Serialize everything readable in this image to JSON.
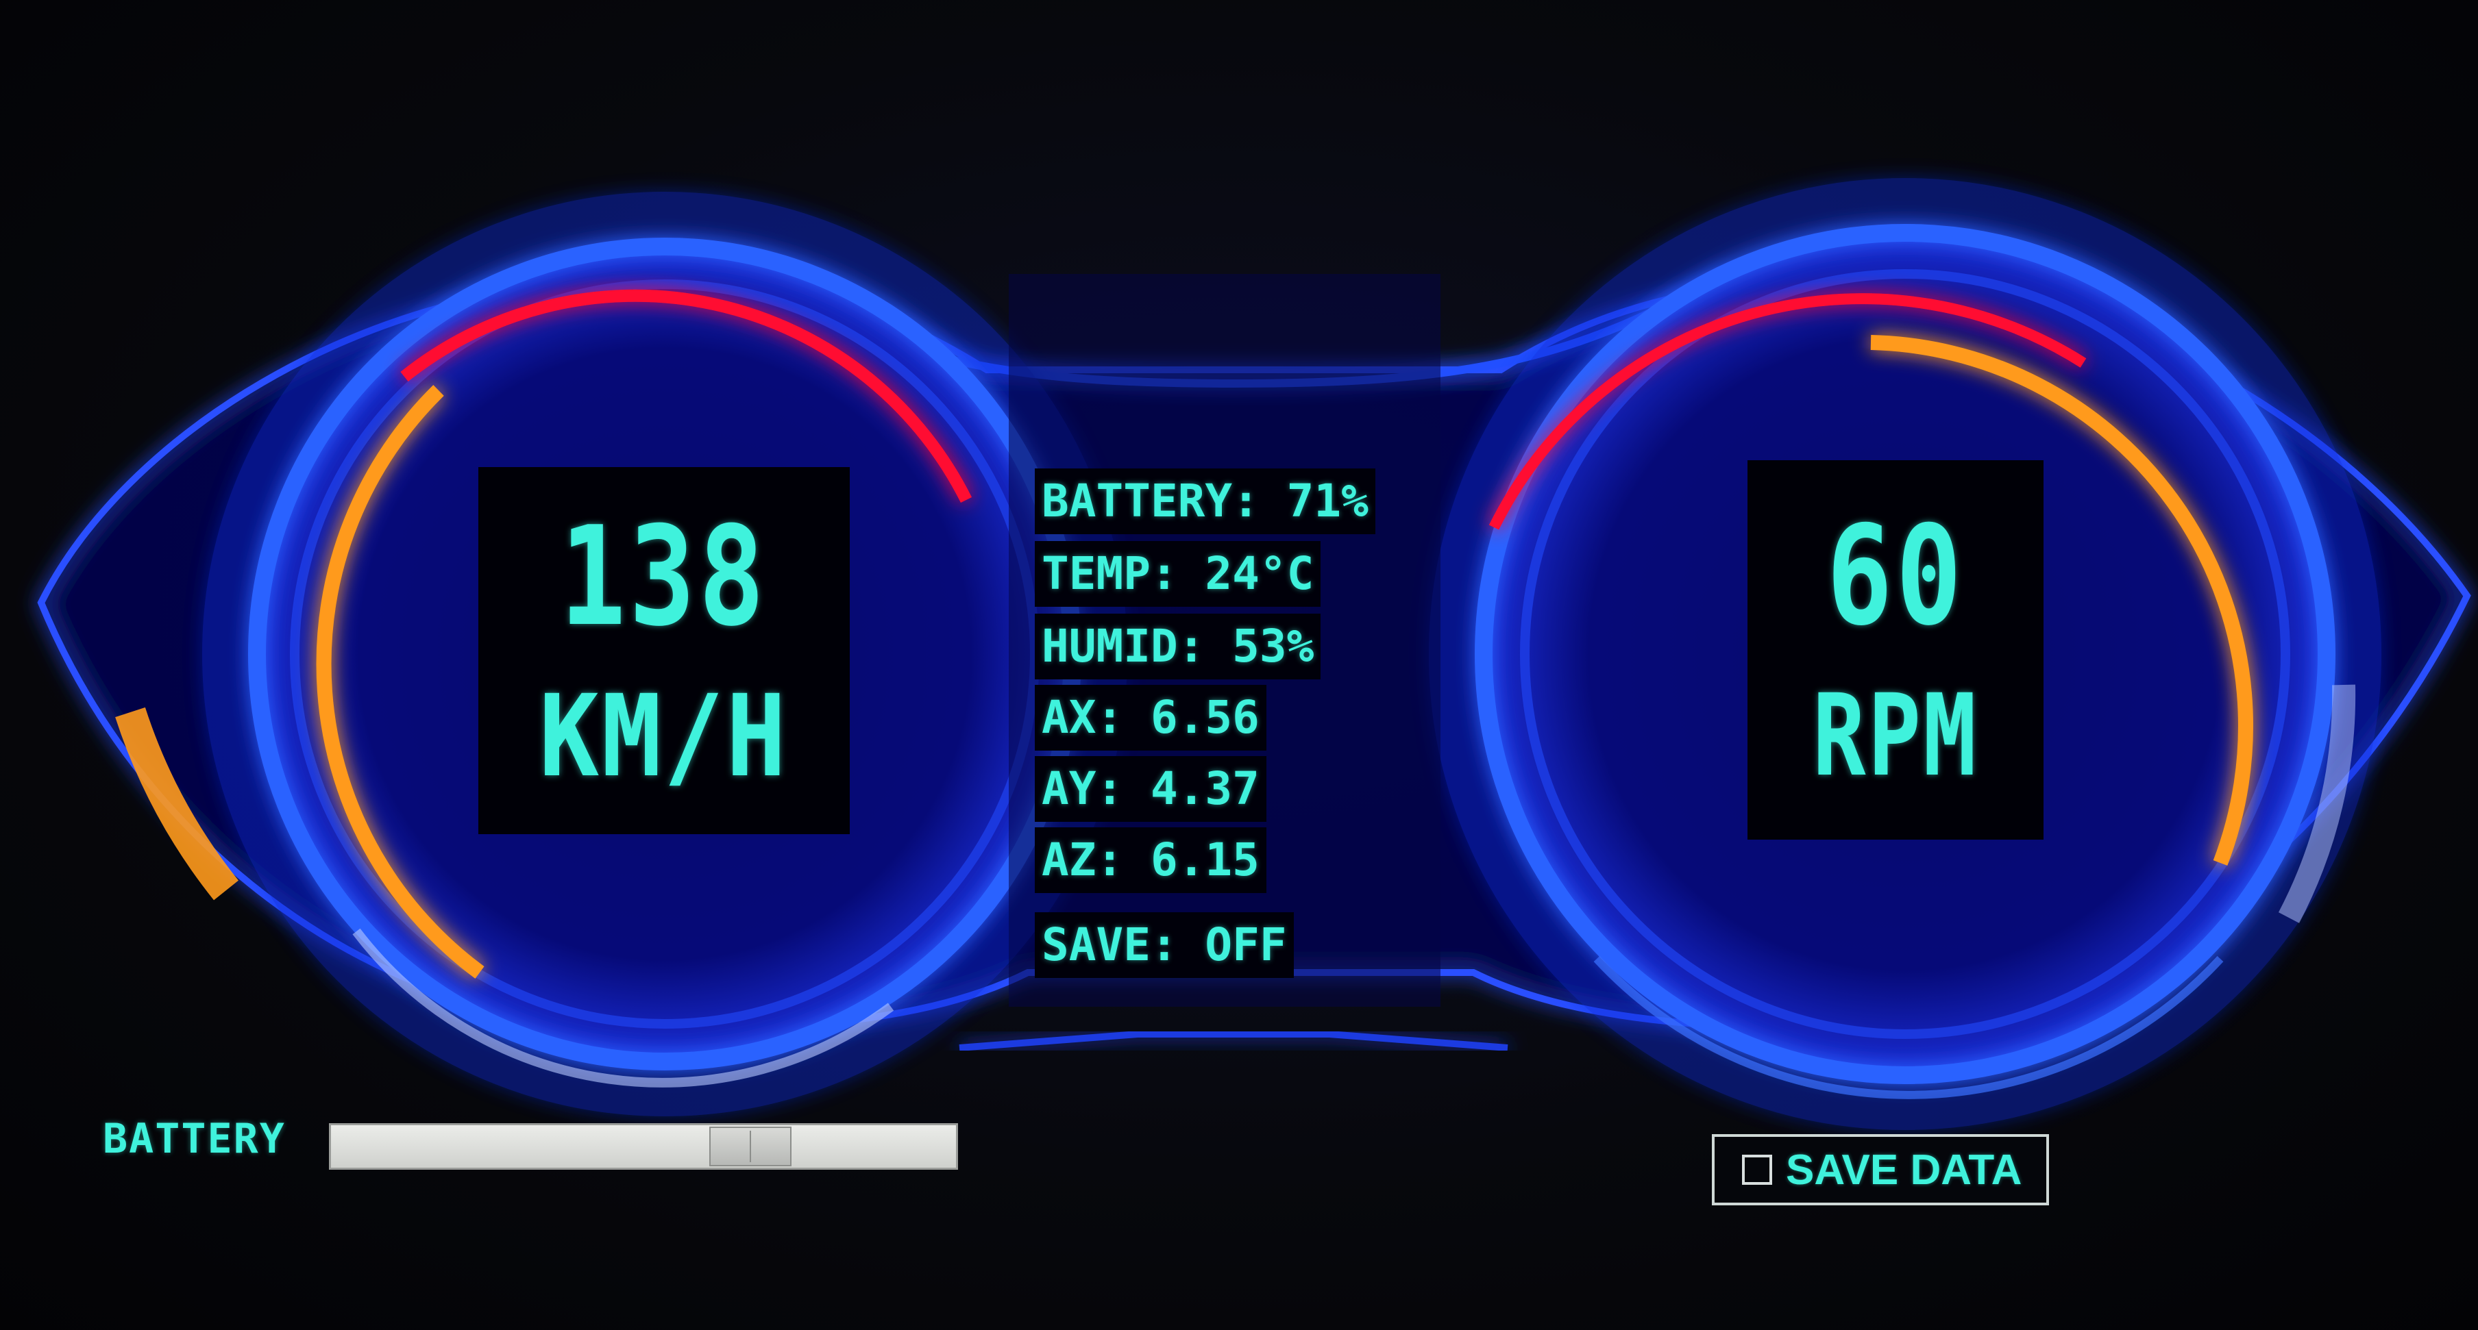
{
  "speedometer": {
    "value": "138",
    "unit": "KM/H"
  },
  "tachometer": {
    "value": "60",
    "unit": "RPM"
  },
  "stats": [
    {
      "id": "battery",
      "text": "BATTERY: 71%"
    },
    {
      "id": "temp",
      "text": "TEMP: 24°C"
    },
    {
      "id": "humid",
      "text": "HUMID: 53%"
    },
    {
      "id": "ax",
      "text": "AX: 6.56"
    },
    {
      "id": "ay",
      "text": "AY: 4.37"
    },
    {
      "id": "az",
      "text": "AZ: 6.15"
    },
    {
      "id": "save",
      "text": "SAVE: OFF"
    }
  ],
  "battery_control": {
    "label": "BATTERY",
    "level_percent": 71
  },
  "save_control": {
    "label": "SAVE DATA",
    "checked": false
  },
  "colors": {
    "lcd_text": "#3ff2dc",
    "gauge_blue": "#1c46ff",
    "gauge_red": "#ff1030",
    "gauge_orange": "#ffa020",
    "panel_background": "#0a0a1a"
  }
}
